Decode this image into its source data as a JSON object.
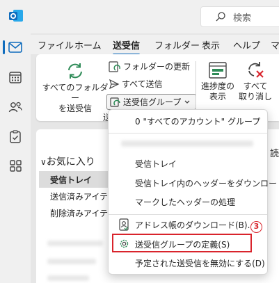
{
  "search": {
    "placeholder": "検索"
  },
  "tabs": [
    "ファイル",
    "ホーム",
    "送受信",
    "フォルダー",
    "表示",
    "ヘルプ",
    "マ"
  ],
  "ribbon": {
    "send_receive_all": "すべてのフォルダー\nを送受信",
    "update_folder": "フォルダーの更新",
    "send_all": "すべて送信",
    "send_receive_groups": "送受信グループ",
    "show_progress": "進捗度の\n表示",
    "cancel_all": "すべて\n取り消し",
    "group_label_fragment": "送"
  },
  "nav": {
    "favorites": "お気に入り",
    "folders": [
      "受信トレイ",
      "送信済みアイテ",
      "削除済みアイテ"
    ]
  },
  "read_label": "読",
  "menu": {
    "items": [
      {
        "text": "0 \"すべてのアカウント\" グループ"
      },
      {
        "text": "受信トレイ"
      },
      {
        "text": "受信トレイ内のヘッダーをダウンロード"
      },
      {
        "text": "マークしたヘッダーの処理"
      },
      {
        "text": "アドレス帳のダウンロード(B)..."
      },
      {
        "text": "送受信グループの定義(S)"
      },
      {
        "text": "予定された送受信を無効にする(D)"
      }
    ]
  },
  "callout": {
    "number": "3"
  },
  "colors": {
    "accent": "#0f6cbd",
    "highlight": "#d9242c",
    "green": "#2e8b57"
  }
}
